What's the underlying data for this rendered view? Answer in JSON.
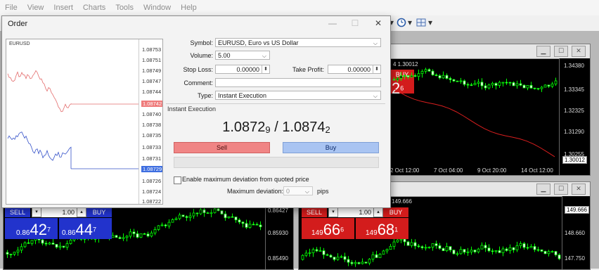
{
  "menu": [
    "File",
    "View",
    "Insert",
    "Charts",
    "Tools",
    "Window",
    "Help"
  ],
  "toolbar": {
    "clock_icon": "clock-icon",
    "grid_icon": "grid-icon"
  },
  "colors": {
    "sell": "#f08585",
    "buy": "#a9c4f2",
    "bear_candle": "#00ff00",
    "bull_candle": "#00ff00"
  },
  "dialog": {
    "title": "Order",
    "minimize_glyph": "—",
    "maximize_glyph": "☐",
    "close_glyph": "✕",
    "mini_chart": {
      "symbol": "EURUSD",
      "prices": [
        "1.08753",
        "1.08751",
        "1.08749",
        "1.08747",
        "1.08744",
        "1.08742",
        "1.08740",
        "1.08738",
        "1.08735",
        "1.08733",
        "1.08731",
        "1.08729",
        "1.08726",
        "1.08724",
        "1.08722"
      ],
      "ask_tag": "1.08742",
      "bid_tag": "1.08729"
    },
    "symbol_label": "Symbol:",
    "symbol_value": "EURUSD, Euro vs US Dollar",
    "volume_label": "Volume:",
    "volume_value": "5.00",
    "stop_loss_label": "Stop Loss:",
    "stop_loss_value": "0.00000",
    "take_profit_label": "Take Profit:",
    "take_profit_value": "0.00000",
    "comment_label": "Comment:",
    "comment_value": "",
    "type_label": "Type:",
    "type_value": "Instant Execution",
    "section_title": "Instant Execution",
    "quote_bid_main": "1.0872",
    "quote_bid_small": "9",
    "quote_sep": " / ",
    "quote_ask_main": "1.0874",
    "quote_ask_small": "2",
    "sell_label": "Sell",
    "buy_label": "Buy",
    "enable_deviation_label": "Enable maximum deviation from quoted price",
    "max_deviation_label": "Maximum deviation:",
    "max_deviation_value": "0",
    "pips_label": "pips"
  },
  "chart_top_right": {
    "header_price": "4 1.30012",
    "buy_label": "BUY",
    "buy_price_big": "2",
    "buy_price_sup": "6",
    "prices": [
      "1.34380",
      "1.33345",
      "1.32325",
      "1.31290",
      "1.30255"
    ],
    "last_price": "1.30012",
    "times": [
      "2 Oct 12:00",
      "7 Oct 04:00",
      "9 Oct 20:00",
      "14 Oct 12:00"
    ]
  },
  "chart_bottom_left": {
    "sell_label": "SELL",
    "volume": "1.00",
    "buy_label": "BUY",
    "sell_prefix": "0.86",
    "sell_big": "42",
    "sell_sup": "7",
    "buy_prefix": "0.86",
    "buy_big": "44",
    "buy_sup": "7",
    "prices": [
      "0.86427",
      "0.85930",
      "0.85490"
    ]
  },
  "chart_bottom_right": {
    "header_price": "149.666",
    "sell_label": "SELL",
    "volume": "1.00",
    "buy_label": "BUY",
    "sell_prefix": "149",
    "sell_big": "66",
    "sell_sup": "6",
    "buy_prefix": "149",
    "buy_big": "68",
    "buy_sup": "1",
    "prices": [
      "149.666",
      "148.660",
      "147.750"
    ]
  }
}
